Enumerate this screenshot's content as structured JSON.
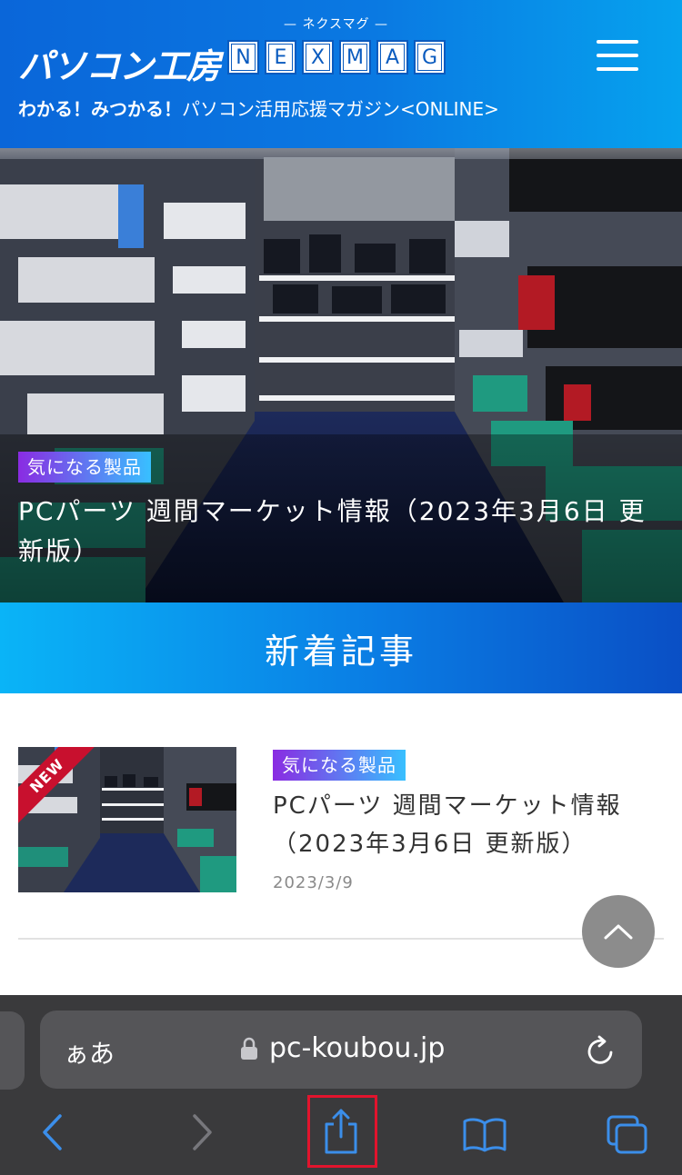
{
  "header": {
    "logo_kana": "— ネクスマグ —",
    "logo_jp": "パソコン工房",
    "logo_letters": [
      "N",
      "E",
      "X",
      "M",
      "A",
      "G"
    ],
    "tagline_bold": "わかる！みつかる！",
    "tagline_rest": "パソコン活用応援マガジン<ONLINE>",
    "menu_icon": "hamburger-menu-icon"
  },
  "hero": {
    "tag": "気になる製品",
    "title": "PCパーツ 週間マーケット情報（2023年3月6日 更新版）",
    "colors": {
      "tag_start": "#8a2be2",
      "tag_end": "#38c0ff"
    }
  },
  "section": {
    "title": "新着記事"
  },
  "articles": [
    {
      "badge": "NEW",
      "tag": "気になる製品",
      "title": "PCパーツ 週間マーケット情報（2023年3月6日 更新版）",
      "date": "2023/3/9"
    }
  ],
  "scroll_top_icon": "chevron-up-icon",
  "browser": {
    "aa_label": "ぁあ",
    "url": "pc-koubou.jp",
    "lock_icon": "lock-icon",
    "reload_icon": "reload-icon",
    "toolbar": [
      "back-icon",
      "forward-icon",
      "share-icon",
      "bookmarks-icon",
      "tabs-icon"
    ],
    "accent": "#3b8eea",
    "highlight_color": "#e2142d"
  }
}
